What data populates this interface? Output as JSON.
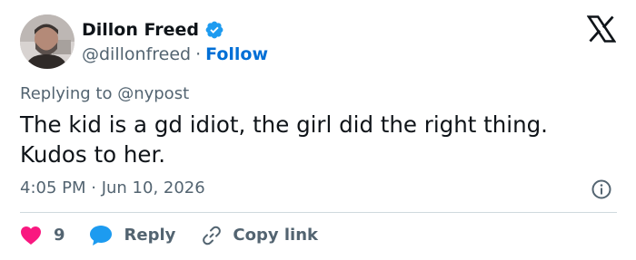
{
  "author": {
    "name": "Dillon Freed",
    "handle": "@dillonfreed",
    "separator": "·",
    "follow_label": "Follow",
    "verified": true
  },
  "header": {
    "logo_icon": "x-logo-icon"
  },
  "tweet": {
    "replying_to": "Replying to @nypost",
    "text": "The kid is a gd idiot, the girl did the right thing. Kudos to her.",
    "timestamp": "4:05 PM · Jun 10, 2026"
  },
  "actions": {
    "like_count": "9",
    "reply_label": "Reply",
    "copy_link_label": "Copy link"
  },
  "colors": {
    "text": "#0f1419",
    "secondary": "#536471",
    "link": "#006fd6",
    "verified": "#1d9bf0",
    "like": "#f91880",
    "reply": "#1d9bf0",
    "divider": "#cfd9de"
  }
}
